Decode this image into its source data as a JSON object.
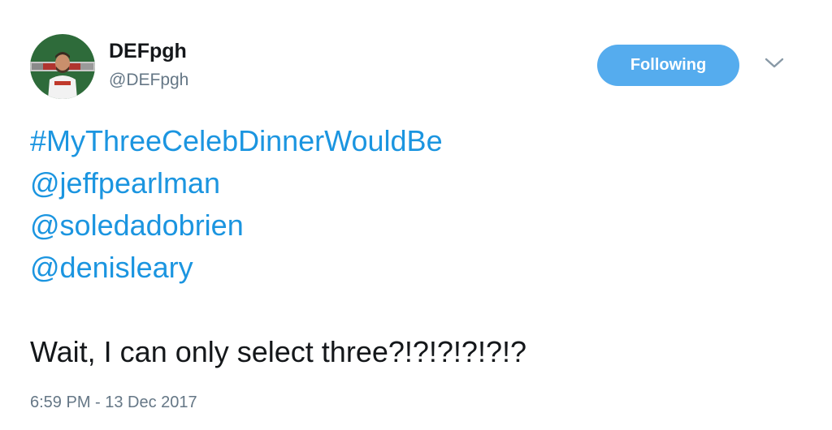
{
  "user": {
    "display_name": "DEFpgh",
    "handle": "@DEFpgh"
  },
  "actions": {
    "follow_label": "Following",
    "menu_icon": "chevron-down-icon"
  },
  "tweet": {
    "hashtag": "#MyThreeCelebDinnerWouldBe",
    "mentions": [
      "@jeffpearlman",
      "@soledadobrien",
      "@denisleary"
    ],
    "text": "Wait, I can only select three?!?!?!?!?!?",
    "timestamp": "6:59 PM - 13 Dec 2017"
  },
  "colors": {
    "accent": "#1b95e0",
    "button": "#55acee",
    "muted": "#657786",
    "text": "#14171a"
  }
}
